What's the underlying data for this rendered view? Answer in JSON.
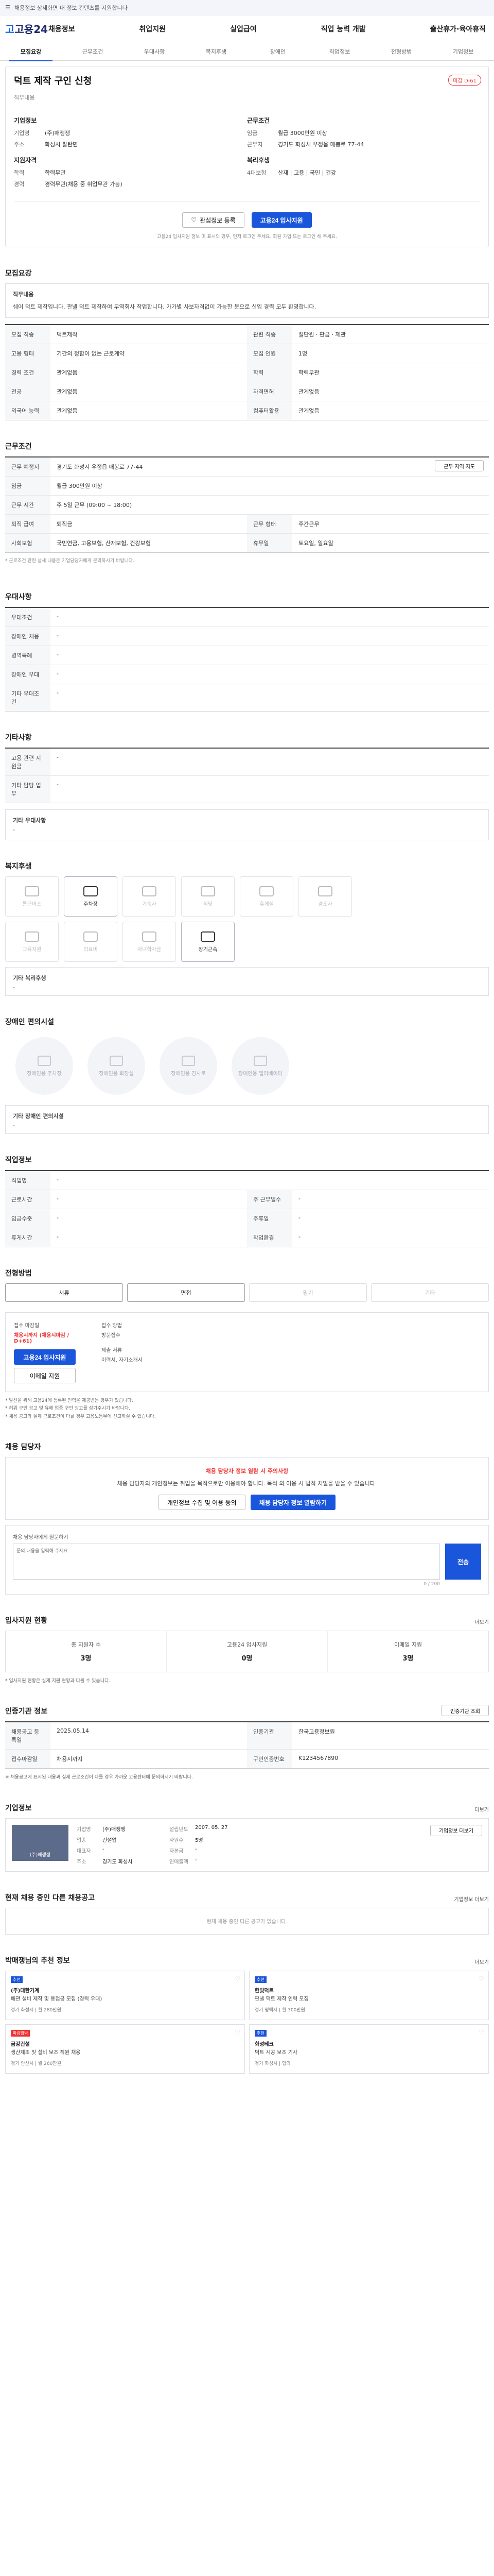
{
  "topbar": {
    "menu_icon": "menu-icon",
    "text": "채용정보 상세화면 내 정보 컨텐츠를 지원합니다",
    "link": "구독하기"
  },
  "gnb": {
    "logo": "고용24",
    "menu": [
      "채용정보",
      "취업지원",
      "실업급여",
      "직업 능력 개발",
      "출산휴가·육아휴직"
    ]
  },
  "tabs": [
    "모집요강",
    "근무조건",
    "우대사항",
    "복지후생",
    "장애인",
    "직업정보",
    "전형방법",
    "기업정보"
  ],
  "job": {
    "title": "덕트 제작 구인 신청",
    "badge": "마감 D-61",
    "subtitle": "직무내용",
    "company": {
      "heading": "기업정보",
      "name_k": "기업명",
      "name_v": "(주)매쟁쟁",
      "addr_k": "주소",
      "addr_v": "화성시 팔탄면"
    },
    "condition": {
      "heading": "근무조건",
      "pay_k": "임금",
      "pay_v": "월급 3000만원 이상",
      "loc_k": "근무지",
      "loc_v": "경기도 화성시 우정읍 매봉로 77-44"
    },
    "qual": {
      "heading": "지원자격",
      "edu_k": "학력",
      "edu_v": "학력무관",
      "career_k": "경력",
      "career_v": "경력무관(채용 중 취업무관 가능)"
    },
    "welfare": {
      "heading": "복리후생",
      "ins_k": "4대보험",
      "ins_v": "산재 | 고용 | 국민 | 건강"
    },
    "btn_scrap": "관심정보 등록",
    "btn_apply": "고용24 입사지원",
    "notice": "고용24 입사지원 정보 미 표시의 경우, 먼저 로그인 주세요. 회원 가입 또는 로그인 해 주세요."
  },
  "recruit": {
    "title": "모집요강",
    "duty_label": "직무내용",
    "duty_text": "쉐어 덕트 제작입니다. 판넬 덕트 제작하여 무역회사 작업합니다. 가가별 사보자격없이 가능한 분으로 신입 경력 모두 환영합니다.",
    "rows": [
      [
        "모집 직종",
        "덕트제작",
        "관련 직종",
        "절단원 · 판금 · 제관"
      ],
      [
        "고용 형태",
        "기간의 정함이 없는 근로계약",
        "모집 인원",
        "1명"
      ],
      [
        "경력 조건",
        "관계없음",
        "학력",
        "학력무관"
      ],
      [
        "전공",
        "관계없음",
        "자격면허",
        "관계없음"
      ],
      [
        "외국어 능력",
        "관계없음",
        "컴퓨터활용",
        "관계없음"
      ]
    ]
  },
  "workcond": {
    "title": "근무조건",
    "rows": [
      [
        "근무 예정지",
        "경기도 화성시 우정읍 매봉로 77-44",
        "",
        "",
        "근무 지역 지도"
      ],
      [
        "임금",
        "월급 300만원 이상",
        "",
        "",
        ""
      ],
      [
        "근무 시간",
        "주 5일 근무 (09:00 ~ 18:00)",
        "",
        "",
        ""
      ],
      [
        "퇴직 급여",
        "퇴직금",
        "근무 형태",
        "주간근무"
      ],
      [
        "사회보험",
        "국민연금, 고용보험, 산재보험, 건강보험",
        "휴무일",
        "토요일, 일요일"
      ]
    ],
    "footnote": "* 근로조건 관련 상세 내용은 기업담당자에게 문의하시기 바랍니다."
  },
  "pref": {
    "title": "우대사항",
    "rows": [
      [
        "우대조건",
        "-"
      ],
      [
        "장애인 채용",
        "-"
      ],
      [
        "병역특례",
        "-"
      ],
      [
        "장애인 우대",
        "-"
      ],
      [
        "기타 우대조건",
        "-"
      ]
    ]
  },
  "etc": {
    "title": "기타사항",
    "rows": [
      [
        "고용 관련 지원금",
        "-"
      ],
      [
        "기타 담당 업무",
        "-"
      ]
    ],
    "box_label": "기타 우대사항",
    "box_text": "-"
  },
  "benefit": {
    "title": "복지후생",
    "items": [
      {
        "label": "통근버스",
        "icon": "bus-icon",
        "on": false
      },
      {
        "label": "주차장",
        "icon": "parking-icon",
        "on": true
      },
      {
        "label": "기숙사",
        "icon": "dorm-icon",
        "on": false
      },
      {
        "label": "식당",
        "icon": "meal-icon",
        "on": false
      },
      {
        "label": "휴게실",
        "icon": "lounge-icon",
        "on": false
      },
      {
        "label": "경조사",
        "icon": "event-icon",
        "on": false
      },
      {
        "label": "교육지원",
        "icon": "edu-icon",
        "on": false
      },
      {
        "label": "의료비",
        "icon": "medical-icon",
        "on": false
      },
      {
        "label": "자녀학자금",
        "icon": "school-icon",
        "on": false
      },
      {
        "label": "장기근속",
        "icon": "award-icon",
        "on": true
      }
    ],
    "etc_label": "기타 복리후생",
    "etc_text": "-"
  },
  "disab": {
    "title": "장애인 편의시설",
    "items": [
      "장애인용 주차장",
      "장애인용 화장실",
      "장애인용 경사로",
      "장애인용 엘리베이터"
    ],
    "etc_label": "기타 장애인 편의시설",
    "etc_text": "-"
  },
  "jobinfo": {
    "title": "직업정보",
    "rows": [
      [
        "직업명",
        "-",
        "",
        ""
      ],
      [
        "근로시간",
        "-",
        "주 근무일수",
        "-"
      ],
      [
        "임금수준",
        "-",
        "주휴일",
        "-"
      ],
      [
        "휴게시간",
        "-",
        "작업환경",
        "-"
      ]
    ]
  },
  "selection": {
    "title": "전형방법",
    "items": [
      {
        "label": "서류",
        "on": true
      },
      {
        "label": "면접",
        "on": true
      },
      {
        "label": "필기",
        "on": false
      },
      {
        "label": "기타",
        "on": false
      }
    ]
  },
  "apply": {
    "period_label": "접수 마감일",
    "period_value": "채용시까지 (채용시마감 / D+61)",
    "method_label": "접수 방법",
    "method_value": "방문접수",
    "btn1": "고용24 입사지원",
    "btn2": "이메일 지원",
    "doc_label": "제출 서류",
    "doc_value": "이력서, 자기소개서",
    "bullets": [
      "* 알선을 위해 고용24에 등록된 인력을 제공받는 경우가 있습니다.",
      "* 허위 구인 광고 및 유해 업종 구인 광고를 삼가주시기 바랍니다.",
      "* 채용 공고와 실제 근로조건이 다를 경우 고용노동부에 신고하실 수 있습니다."
    ]
  },
  "contact": {
    "title": "채용 담당자",
    "lock_title": "채용 담당자 정보 열람 시 주의사항",
    "lock_text": "채용 담당자의 개인정보는 취업을 목적으로만 이용해야 합니다. 목적 외 이용 시 법적 처벌을 받을 수 있습니다.",
    "btn1": "개인정보 수집 및 이용 동의",
    "btn2": "채용 담당자 정보 열람하기",
    "q_label": "채용 담당자에게 질문하기",
    "q_placeholder": "문의 내용을 입력해 주세요.",
    "q_btn": "전송",
    "q_count": "0 / 200"
  },
  "stats": {
    "title": "입사지원 현황",
    "more": "더보기",
    "items": [
      {
        "label": "총 지원자 수",
        "value": "3명"
      },
      {
        "label": "고용24 입사지원",
        "value": "0명"
      },
      {
        "label": "이메일 지원",
        "value": "3명"
      }
    ],
    "note": "* 입사지원 현황은 실제 지원 현황과 다를 수 있습니다."
  },
  "reginfo": {
    "title": "인증기관 정보",
    "btn": "인증기관 조회",
    "rows": [
      [
        "채용공고 등록일",
        "2025.05.14",
        "인증기관",
        "한국고용정보원"
      ],
      [
        "접수마감일",
        "채용시까지",
        "구인인증번호",
        "K1234567890"
      ]
    ],
    "note": "※ 채용공고에 표시된 내용과 실제 근로조건이 다를 경우 가까운 고용센터에 문의하시기 바랍니다."
  },
  "corp": {
    "title": "기업정보",
    "more": "더보기",
    "img_caption": "(주)매쟁쟁",
    "btn": "기업정보 더보기",
    "fields": [
      [
        "기업명",
        "(주)매쟁쟁",
        "설립년도",
        "2007. 05. 27"
      ],
      [
        "업종",
        "건설업",
        "사원수",
        "5명"
      ],
      [
        "대표자",
        "-",
        "자본금",
        "-"
      ],
      [
        "주소",
        "경기도 화성시",
        "연매출액",
        "-"
      ]
    ]
  },
  "others": {
    "title": "현재 채용 중인 다른 채용공고",
    "more": "기업정보 더보기",
    "empty": "현재 채용 중인 다른 공고가 없습니다."
  },
  "recommend": {
    "title": "박매쟁님의 추천 정보",
    "more": "더보기",
    "cards": [
      {
        "tag": "추천",
        "alt": false,
        "company": "(주)대한기계",
        "title": "배관 설비 제작 및 용접공 모집 (경력 우대)",
        "meta": "경기 화성시 | 월 280만원"
      },
      {
        "tag": "추천",
        "alt": false,
        "company": "한빛덕트",
        "title": "판넬 덕트 제작 인력 모집",
        "meta": "경기 평택시 | 월 300만원"
      },
      {
        "tag": "마감임박",
        "alt": true,
        "company": "금강건설",
        "title": "생산제조 및 설비 보조 직원 채용",
        "meta": "경기 안산시 | 월 260만원"
      },
      {
        "tag": "추천",
        "alt": false,
        "company": "화성테크",
        "title": "덕트 시공 보조 기사",
        "meta": "경기 화성시 | 협의"
      }
    ]
  }
}
